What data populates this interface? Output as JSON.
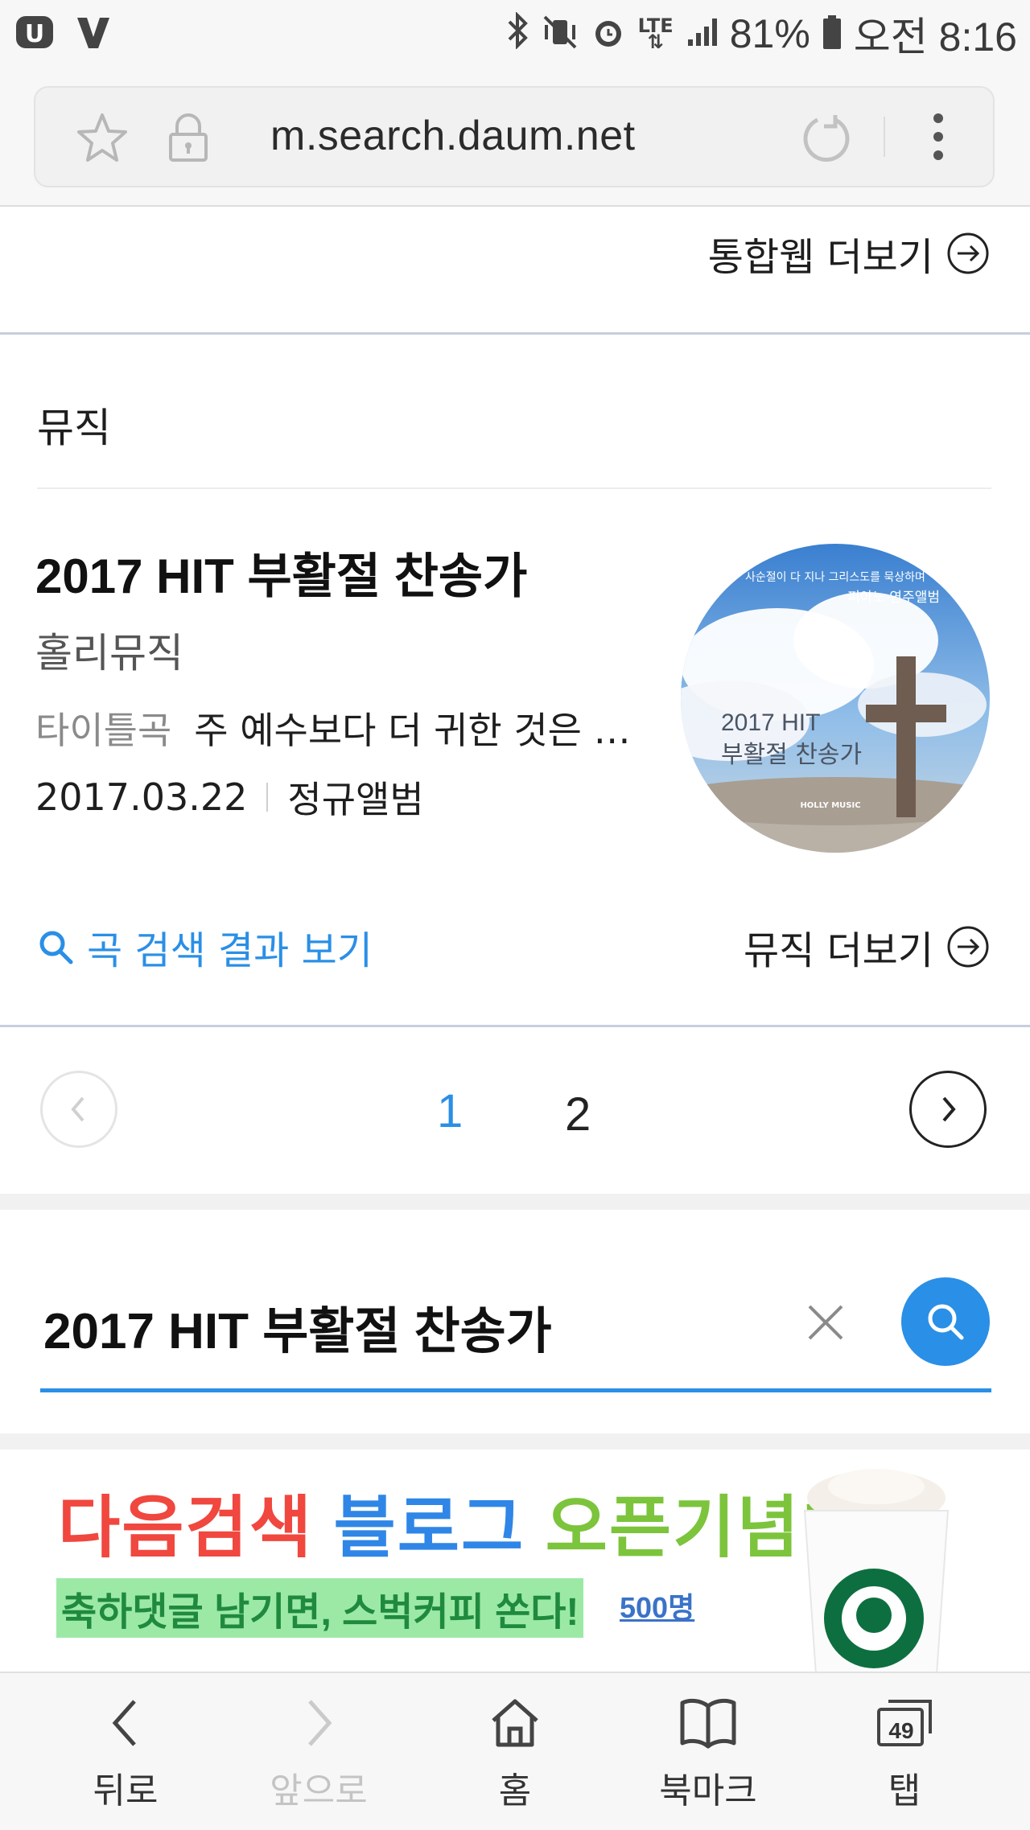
{
  "status_bar": {
    "left_icons": [
      "app-u-icon",
      "app-v-icon"
    ],
    "network": "LTE",
    "battery_percent": "81%",
    "time": "오전 8:16"
  },
  "browser": {
    "url": "m.search.daum.net"
  },
  "web_section": {
    "more_label": "통합웹 더보기"
  },
  "music_section": {
    "title": "뮤직",
    "album": {
      "title": "2017 HIT 부활절 찬송가",
      "artist": "홀리뮤직",
      "track_label": "타이틀곡",
      "track_name": "주 예수보다 더 귀한 것은 …",
      "release_date": "2017.03.22",
      "album_type": "정규앨범",
      "cover": {
        "top_text": "사순절이 다 지나 그리스도를 묵상하며",
        "badge": "피아노 연주앨범",
        "line1": "2017 HIT",
        "line2": "부활절 찬송가",
        "brand": "HOLLY MUSIC"
      }
    },
    "song_search_label": "곡 검색 결과 보기",
    "more_label": "뮤직 더보기"
  },
  "pagination": {
    "pages": [
      "1",
      "2"
    ],
    "current": "1"
  },
  "search": {
    "query": "2017 HIT 부활절 찬송가"
  },
  "banner": {
    "headline_part1": "다음검색",
    "headline_part2": "블로그",
    "headline_part3": "오픈기념!",
    "subline": "축하댓글 남기면, 스벅커피 쏜다!",
    "count": "500명",
    "colors": {
      "red": "#f0473f",
      "blue": "#2f86e6",
      "green": "#7cc43c"
    }
  },
  "bottom_nav": {
    "back": "뒤로",
    "forward": "앞으로",
    "home": "홈",
    "bookmarks": "북마크",
    "tabs": "탭",
    "tab_count": "49"
  },
  "colors": {
    "accent": "#2a8fe6"
  }
}
